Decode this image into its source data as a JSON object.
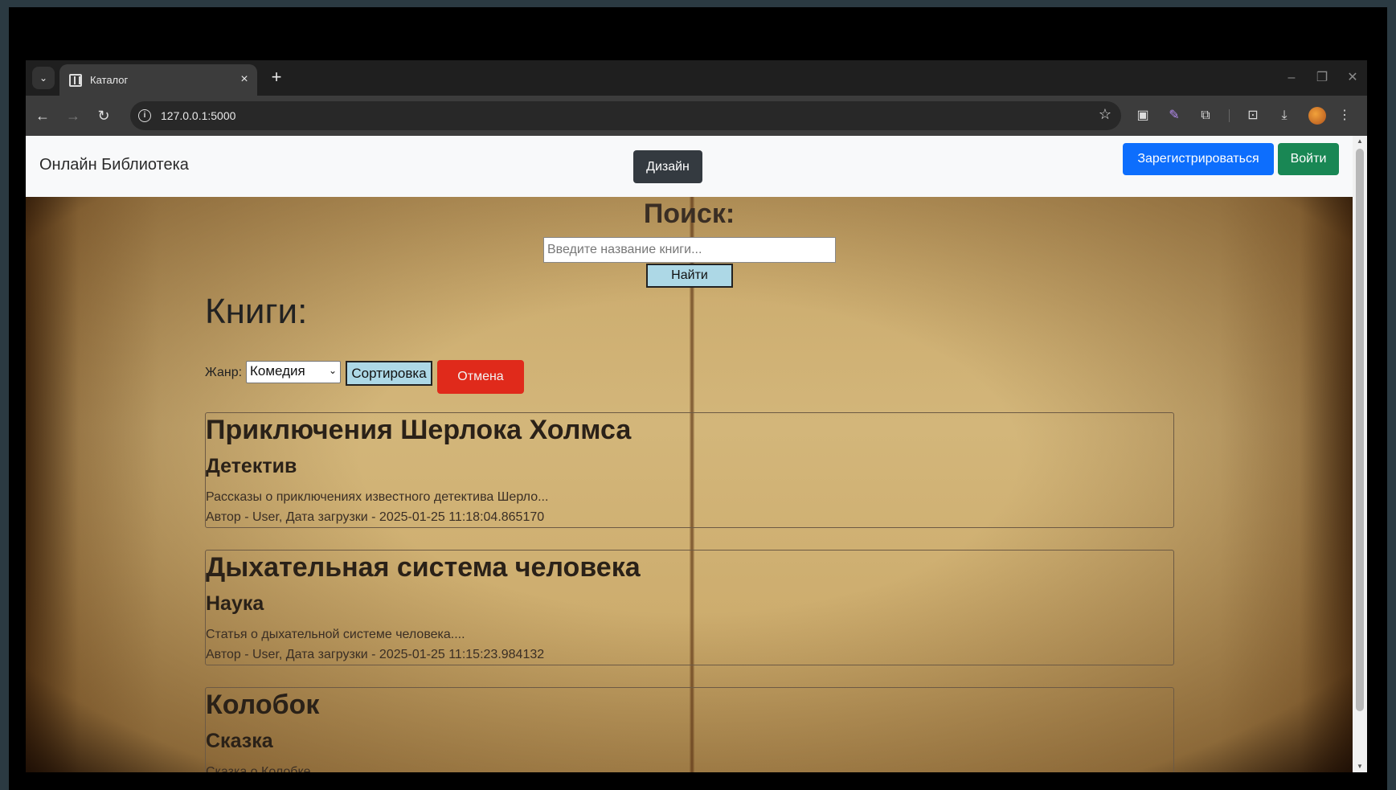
{
  "browser": {
    "tab_title": "Каталог",
    "tab_close": "×",
    "new_tab": "+",
    "tab_menu": "⌄",
    "url": "127.0.0.1:5000",
    "window_controls": {
      "minimize": "–",
      "restore": "❐",
      "close": "✕"
    },
    "nav": {
      "back": "←",
      "forward": "→",
      "reload": "↻"
    },
    "icons": {
      "star": "☆",
      "info": "i"
    }
  },
  "navbar": {
    "brand": "Онлайн Библиотека",
    "design_button": "Дизайн",
    "register_button": "Зарегистрироваться",
    "login_button": "Войти"
  },
  "search": {
    "title": "Поиск:",
    "placeholder": "Введите название книги...",
    "button": "Найти"
  },
  "books_section": {
    "title": "Книги:",
    "genre_label": "Жанр:",
    "genre_selected": "Комедия",
    "sort_button": "Сортировка",
    "cancel_button": "Отмена"
  },
  "books": [
    {
      "title": "Приключения Шерлока Холмса",
      "genre": "Детектив",
      "description": "Рассказы о приключениях известного детектива Шерло...",
      "meta": "Автор - User, Дата загрузки - 2025-01-25 11:18:04.865170"
    },
    {
      "title": "Дыхательная система человека",
      "genre": "Наука",
      "description": "Статья о дыхательной системе человека....",
      "meta": "Автор - User, Дата загрузки - 2025-01-25 11:15:23.984132"
    },
    {
      "title": "Колобок",
      "genre": "Сказка",
      "description": "Сказка о Колобке...",
      "meta": ""
    }
  ],
  "colors": {
    "register": "#0d6efd",
    "login": "#198754",
    "cancel": "#e02a1b",
    "design": "#343a40",
    "search_button": "#add8e6"
  }
}
